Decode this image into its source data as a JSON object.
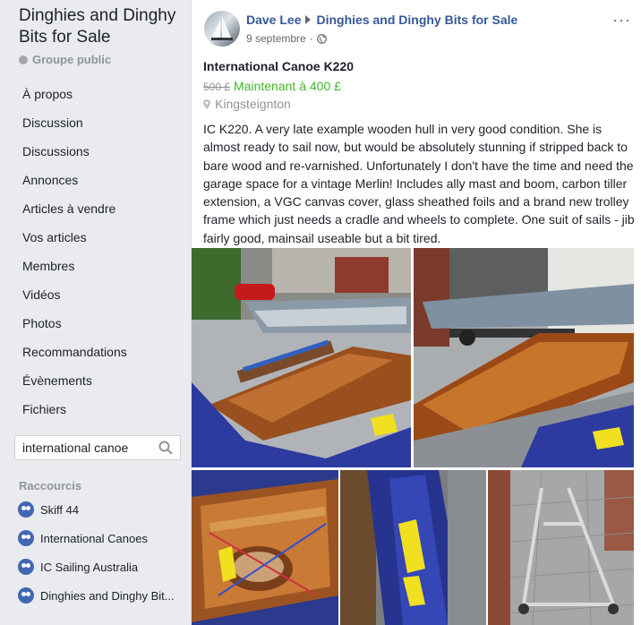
{
  "group": {
    "title": "Dinghies and Dinghy Bits for Sale",
    "privacy": "Groupe public"
  },
  "nav": [
    "À propos",
    "Discussion",
    "Discussions",
    "Annonces",
    "Articles à vendre",
    "Vos articles",
    "Membres",
    "Vidéos",
    "Photos",
    "Recommandations",
    "Évènements",
    "Fichiers"
  ],
  "search": {
    "value": "international canoe",
    "icon": "search-icon"
  },
  "shortcuts": {
    "heading": "Raccourcis",
    "items": [
      "Skiff 44",
      "International Canoes",
      "IC Sailing Australia",
      "Dinghies and Dinghy Bit..."
    ]
  },
  "post": {
    "author": "Dave Lee",
    "group": "Dinghies and Dinghy Bits for Sale",
    "date": "9 septembre",
    "audience_icon": "globe-icon",
    "more": "···",
    "title": "International Canoe K220",
    "old_price": "500 £",
    "new_price": "Maintenant à 400 £",
    "location": "Kingsteignton",
    "description": "IC K220. A very late example wooden hull in very good condition. She is almost ready to sail now, but would be absolutely stunning if stripped back to bare wood and re-varnished. Unfortunately I don't have the time and need the garage space for a vintage Merlin! Includes ally mast and boom, carbon tiller extension, a VGC canvas cover, glass sheathed foils and a brand new trolley frame which just needs a cradle and wheels to complete. One suit of sails - jib fairly good, mainsail useable but a bit tired."
  },
  "colors": {
    "link": "#365899",
    "price_new": "#42b72a",
    "sidebar_bg": "#e9ebee"
  }
}
